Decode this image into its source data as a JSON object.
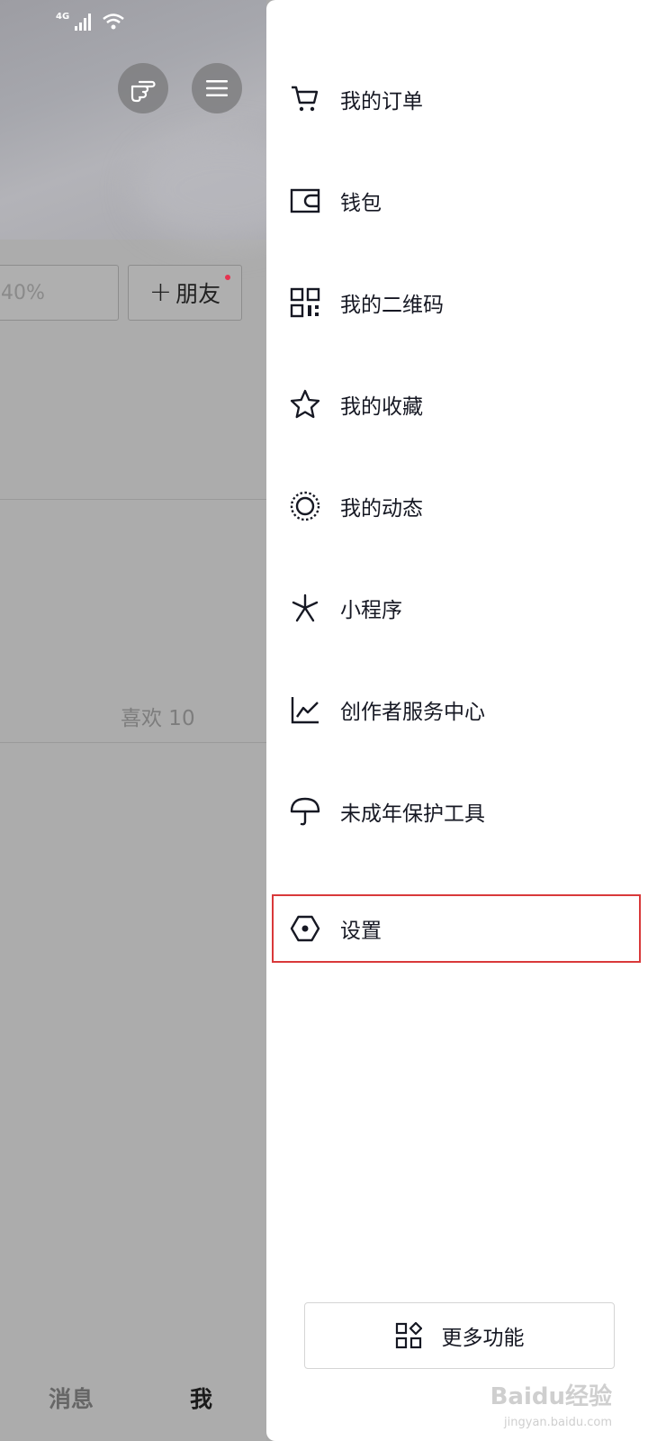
{
  "status_bar": {
    "network": "4G"
  },
  "profile_bg": {
    "percent_text": "40%",
    "add_friend_label": "朋友",
    "add_friend_plus": "+",
    "likes_text": "喜欢 10"
  },
  "bottom_nav": {
    "messages": "消息",
    "me": "我"
  },
  "drawer": {
    "items": [
      {
        "label": "我的订单",
        "icon": "cart-icon"
      },
      {
        "label": "钱包",
        "icon": "wallet-icon"
      },
      {
        "label": "我的二维码",
        "icon": "qr-code-icon"
      },
      {
        "label": "我的收藏",
        "icon": "star-icon"
      },
      {
        "label": "我的动态",
        "icon": "moments-icon"
      },
      {
        "label": "小程序",
        "icon": "mini-program-icon"
      },
      {
        "label": "创作者服务中心",
        "icon": "chart-icon"
      },
      {
        "label": "未成年保护工具",
        "icon": "umbrella-icon"
      },
      {
        "label": "设置",
        "icon": "settings-hexagon-icon"
      }
    ],
    "highlight_color": "#d9393a",
    "more_label": "更多功能"
  },
  "watermark": {
    "brand": "Baidu经验",
    "url": "jingyan.baidu.com"
  }
}
